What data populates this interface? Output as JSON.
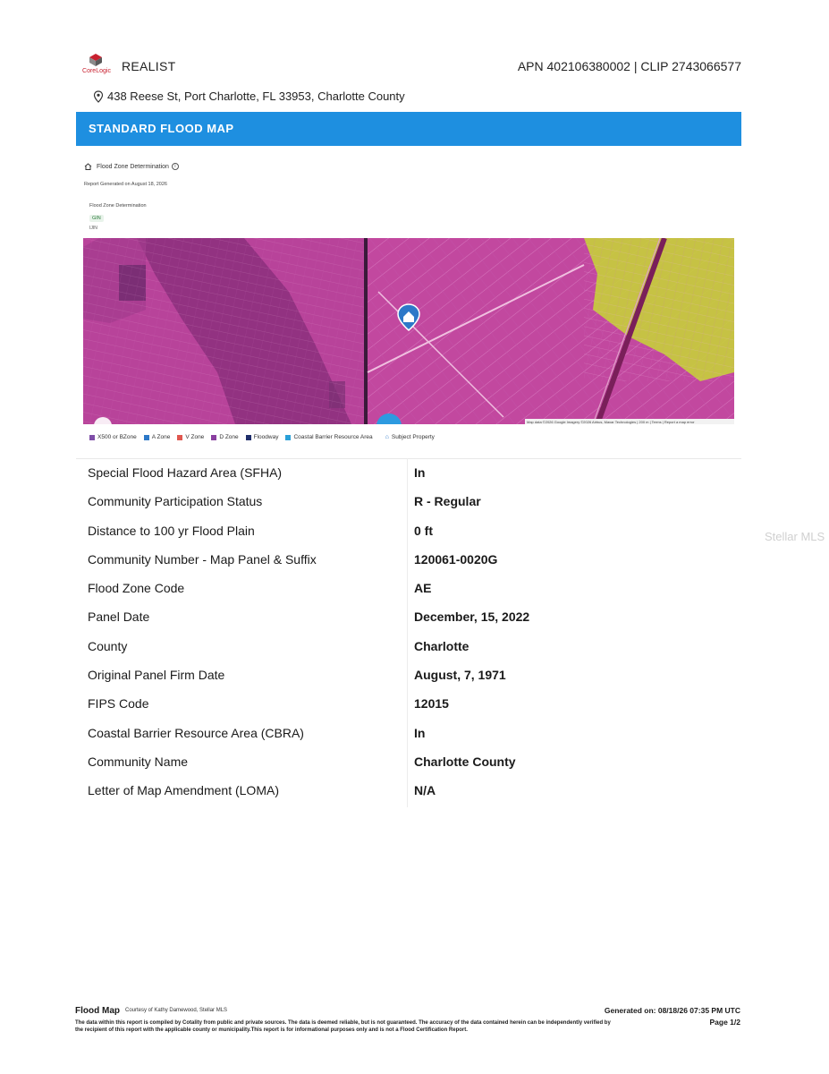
{
  "header": {
    "logo_text": "CoreLogic",
    "brand": "REALIST",
    "apn_clip": "APN 402106380002 | CLIP 2743066577"
  },
  "address": "438 Reese St, Port Charlotte, FL 33953, Charlotte County",
  "banner_title": "STANDARD FLOOD MAP",
  "flood_zone": {
    "heading": "Flood Zone Determination",
    "report_generated": "Report Generated on August 18, 2026",
    "label": "Flood Zone Determination",
    "badge": "GIN",
    "sub": "IJIN"
  },
  "map": {
    "attribution": "Map data ©2026 Google Imagery ©2026 Airbus, Maxar Technologies | 200 m | Terms | Report a map error"
  },
  "legend": [
    {
      "label": "X500 or BZone",
      "color": "#7f4ea8"
    },
    {
      "label": "A Zone",
      "color": "#2d78c8"
    },
    {
      "label": "V Zone",
      "color": "#e0574f"
    },
    {
      "label": "D Zone",
      "color": "#8a3fa0"
    },
    {
      "label": "Floodway",
      "color": "#1f2e6b"
    },
    {
      "label": "Coastal Barrier Resource Area",
      "color": "#2aa0d8"
    },
    {
      "label": "Subject Property",
      "color": "#2d78c8"
    }
  ],
  "details": [
    {
      "label": "Special Flood Hazard Area (SFHA)",
      "value": "In"
    },
    {
      "label": "Community Participation Status",
      "value": "R - Regular"
    },
    {
      "label": "Distance to 100 yr Flood Plain",
      "value": "0 ft"
    },
    {
      "label": "Community Number - Map Panel & Suffix",
      "value": "120061-0020G"
    },
    {
      "label": "Flood Zone Code",
      "value": "AE"
    },
    {
      "label": "Panel Date",
      "value": "December, 15, 2022"
    },
    {
      "label": "County",
      "value": "Charlotte"
    },
    {
      "label": "Original Panel Firm Date",
      "value": "August, 7, 1971"
    },
    {
      "label": "FIPS Code",
      "value": "12015"
    },
    {
      "label": "Coastal Barrier Resource Area (CBRA)",
      "value": "In"
    },
    {
      "label": "Community Name",
      "value": "Charlotte County"
    },
    {
      "label": "Letter of Map Amendment (LOMA)",
      "value": "N/A"
    }
  ],
  "watermark": "Stellar MLS",
  "footer": {
    "title": "Flood Map",
    "courtesy": "Courtesy of Kathy Damewood, Stellar MLS",
    "generated": "Generated on: 08/18/26 07:35 PM UTC",
    "page": "Page 1/2",
    "disclaimer": "The data within this report is compiled by Cotality from public and private sources. The data is deemed reliable, but is not guaranteed. The accuracy of the data contained herein can be independently verified by the recipient of this report with the applicable county or municipality.This report is for informational purposes only and is not a Flood Certification Report."
  }
}
